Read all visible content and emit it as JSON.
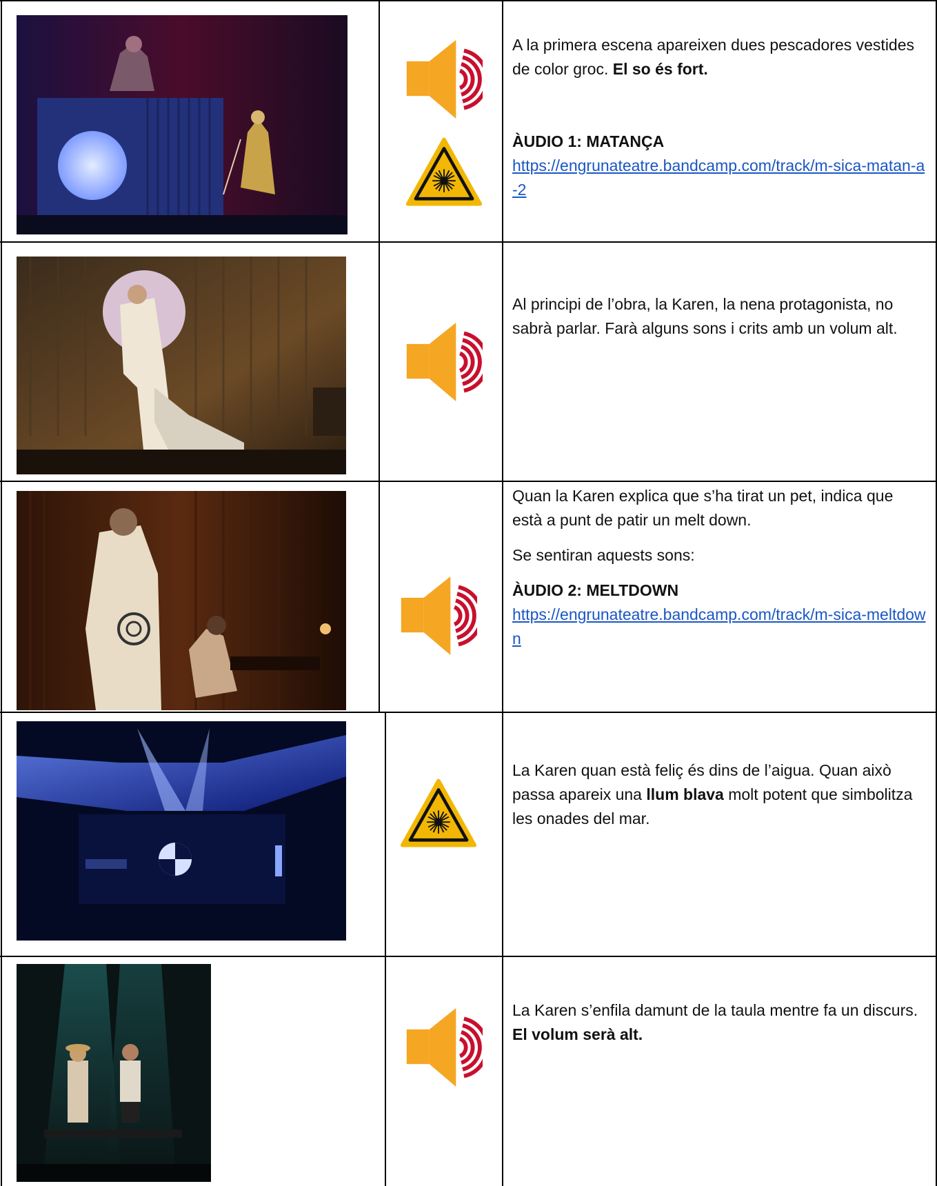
{
  "rows": [
    {
      "photo": "stage-photo-fishermen",
      "icons": [
        "speaker-loud-icon",
        "laser-warning-icon"
      ],
      "text_plain": "A la primera escena apareixen dues pescadores vestides de color groc.",
      "text_bold": "El so és fort.",
      "audio_title": "ÀUDIO  1: MATANÇA",
      "audio_link": "https://engrunateatre.bandcamp.com/track/m-sica-matan-a-2"
    },
    {
      "photo": "stage-photo-karen-dragged",
      "icons": [
        "speaker-loud-icon"
      ],
      "text_plain": "Al principi de l’obra, la Karen, la nena protagonista, no sabrà parlar. Farà alguns sons i crits amb un volum alt."
    },
    {
      "photo": "stage-photo-meltdown",
      "icons": [
        "speaker-loud-icon"
      ],
      "text_p1": "Quan la Karen explica que s’ha tirat un pet, indica que està a punt de patir un melt down.",
      "text_p2": "Se sentiran aquests sons:",
      "audio_title": "ÀUDIO 2: MELTDOWN",
      "audio_link": "https://engrunateatre.bandcamp.com/track/m-sica-meltdown"
    },
    {
      "photo": "stage-photo-blue-light",
      "icons": [
        "laser-warning-icon"
      ],
      "text_before": "La Karen quan està feliç és dins de l’aigua. Quan això passa apareix una",
      "text_bold": "llum blava",
      "text_after": "molt potent que simbolitza les onades del mar."
    },
    {
      "photo": "stage-photo-speech-on-table",
      "icons": [
        "speaker-loud-icon"
      ],
      "text_plain": "La Karen s’enfila damunt de la taula mentre fa un discurs.",
      "text_bold": "El volum serà alt."
    }
  ],
  "colors": {
    "speaker_orange": "#f5a623",
    "sound_wave_red": "#c8102e",
    "warning_yellow": "#f2b705",
    "link_blue": "#1a56c4"
  }
}
